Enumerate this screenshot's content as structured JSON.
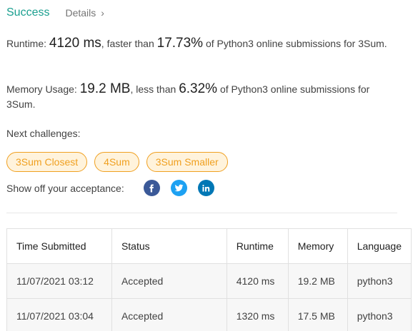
{
  "header": {
    "status": "Success",
    "details_label": "Details",
    "details_chevron": "›"
  },
  "runtime": {
    "label": "Runtime:",
    "value": "4120 ms",
    "comparison_text": ", faster than",
    "percent": "17.73%",
    "suffix": "of Python3 online submissions for 3Sum."
  },
  "memory": {
    "label": "Memory Usage:",
    "value": "19.2 MB",
    "comparison_text": ", less than",
    "percent": "6.32%",
    "suffix": "of Python3 online submissions for 3Sum."
  },
  "next_challenges": {
    "label": "Next challenges:",
    "items": [
      {
        "label": "3Sum Closest"
      },
      {
        "label": "4Sum"
      },
      {
        "label": "3Sum Smaller"
      }
    ]
  },
  "share": {
    "label": "Show off your acceptance:",
    "icons": [
      "facebook-icon",
      "twitter-icon",
      "linkedin-icon"
    ]
  },
  "submissions": {
    "columns": [
      "Time Submitted",
      "Status",
      "Runtime",
      "Memory",
      "Language"
    ],
    "rows": [
      {
        "time": "11/07/2021 03:12",
        "status": "Accepted",
        "runtime": "4120 ms",
        "memory": "19.2 MB",
        "language": "python3"
      },
      {
        "time": "11/07/2021 03:04",
        "status": "Accepted",
        "runtime": "1320 ms",
        "memory": "17.5 MB",
        "language": "python3"
      }
    ]
  },
  "colors": {
    "success": "#1a9f8f",
    "accepted": "#2db55d",
    "chip_border": "#f0a020",
    "chip_bg": "#fff3dc",
    "facebook": "#3b5998",
    "twitter": "#1da1f2",
    "linkedin": "#0077b5"
  }
}
